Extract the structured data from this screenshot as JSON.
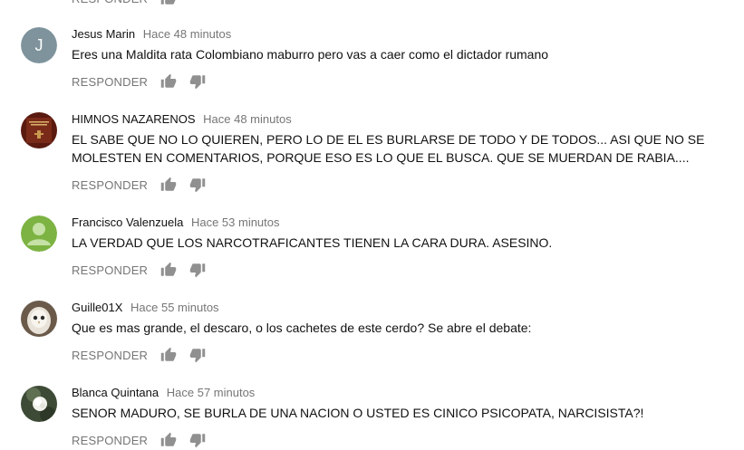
{
  "actions": {
    "reply_label": "RESPONDER"
  },
  "colors": {
    "meta": "#767676",
    "icon": "#909090",
    "text": "#111111"
  },
  "comments": [
    {
      "author": "Jesus Marin",
      "time": "Hace 48 minutos",
      "text": "Eres una Maldita rata  Colombiano maburro pero vas a caer como el dictador rumano",
      "avatar_letter": "J",
      "avatar_color": "#7f939c"
    },
    {
      "author": "HIMNOS NAZARENOS",
      "time": "Hace 48 minutos",
      "text": "EL SABE QUE NO LO QUIEREN, PERO LO DE EL ES BURLARSE DE TODO Y DE TODOS... ASI QUE NO SE MOLESTEN EN COMENTARIOS, PORQUE ESO ES LO QUE EL BUSCA. QUE SE MUERDAN DE RABIA...."
    },
    {
      "author": "Francisco Valenzuela",
      "time": "Hace 53 minutos",
      "text": "LA VERDAD QUE LOS NARCOTRAFICANTES TIENEN LA CARA DURA. ASESINO."
    },
    {
      "author": "Guille01X",
      "time": "Hace 55 minutos",
      "text": "Que es mas grande, el descaro, o los cachetes de este cerdo? Se abre el debate:"
    },
    {
      "author": "Blanca Quintana",
      "time": "Hace 57 minutos",
      "text": "SENOR MADURO, SE BURLA DE UNA NACION O USTED ES CINICO PSICOPATA, NARCISISTA?!"
    }
  ]
}
